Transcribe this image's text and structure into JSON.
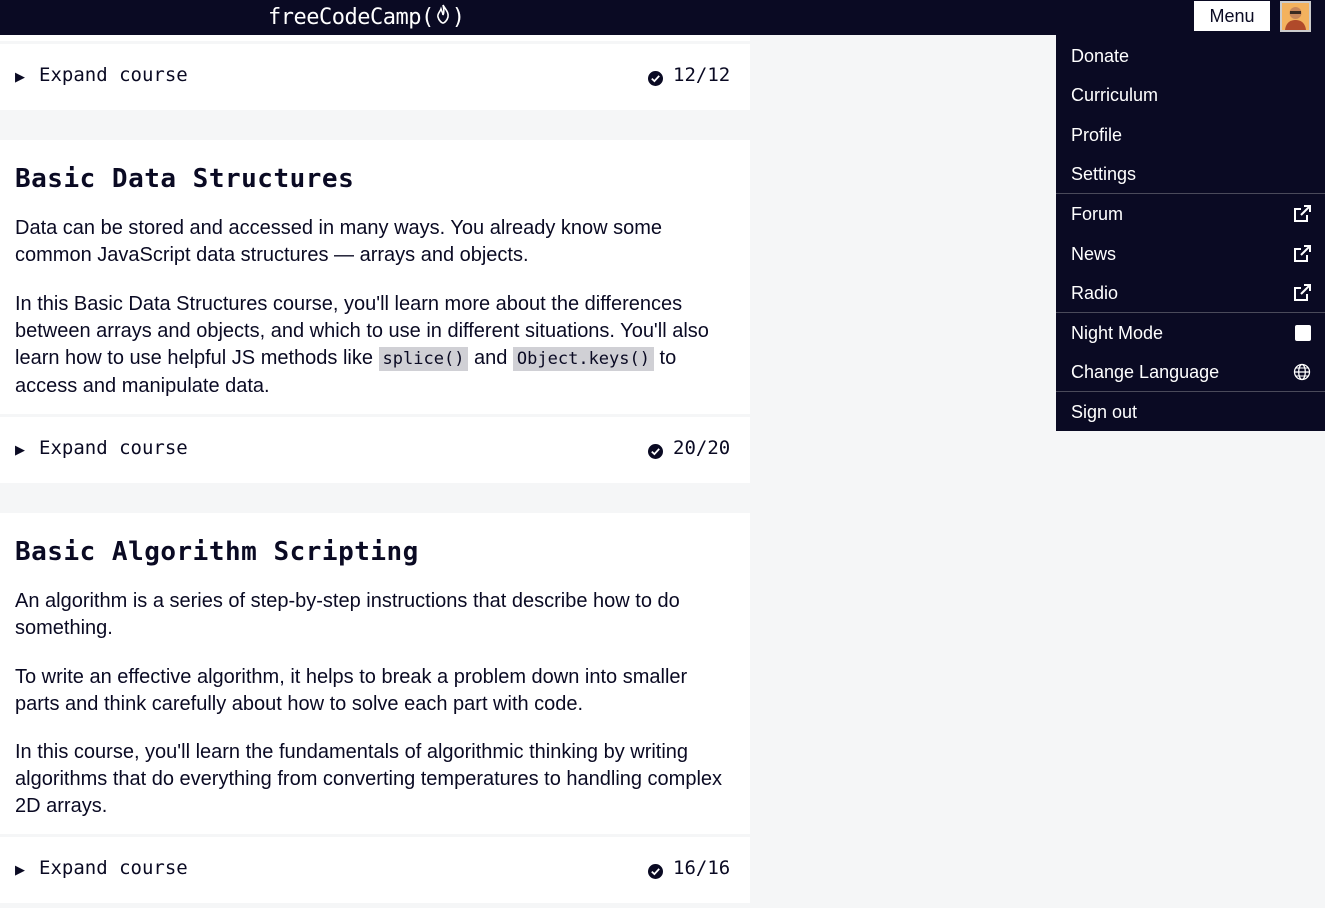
{
  "navbar": {
    "logo": "freeCodeCamp",
    "logo_paren_open": "(",
    "logo_paren_close": ")",
    "menu_label": "Menu"
  },
  "menu": {
    "items": [
      {
        "label": "Donate"
      },
      {
        "label": "Curriculum"
      },
      {
        "label": "Profile"
      },
      {
        "label": "Settings"
      },
      {
        "label": "Forum",
        "icon": "external-link-icon"
      },
      {
        "label": "News",
        "icon": "external-link-icon"
      },
      {
        "label": "Radio",
        "icon": "external-link-icon"
      },
      {
        "label": "Night Mode",
        "icon": "toggle-checkbox-icon"
      },
      {
        "label": "Change Language",
        "icon": "globe-icon"
      },
      {
        "label": "Sign out"
      }
    ]
  },
  "courses": [
    {
      "expand_label": "Expand course",
      "progress": "12/12"
    },
    {
      "title": "Basic Data Structures",
      "para1": "Data can be stored and accessed in many ways. You already know some common JavaScript data structures — arrays and objects.",
      "para2_a": "In this Basic Data Structures course, you'll learn more about the differences between arrays and objects, and which to use in different situations. You'll also learn how to use helpful JS methods like ",
      "para2_code1": "splice()",
      "para2_b": " and ",
      "para2_code2": "Object.keys()",
      "para2_c": " to access and manipulate data.",
      "expand_label": "Expand course",
      "progress": "20/20"
    },
    {
      "title": "Basic Algorithm Scripting",
      "para1": "An algorithm is a series of step-by-step instructions that describe how to do something.",
      "para2": "To write an effective algorithm, it helps to break a problem down into smaller parts and think carefully about how to solve each part with code.",
      "para3": "In this course, you'll learn the fundamentals of algorithmic thinking by writing algorithms that do everything from converting temperatures to handling complex 2D arrays.",
      "expand_label": "Expand course",
      "progress": "16/16"
    }
  ],
  "colors": {
    "nav_bg": "#0a0a23",
    "page_bg": "#f5f6f7",
    "card_bg": "#ffffff",
    "code_bg": "#d0d0d5"
  }
}
